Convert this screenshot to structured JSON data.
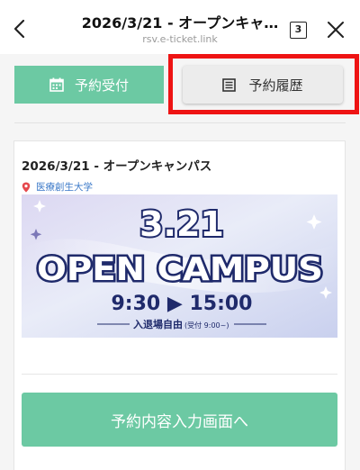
{
  "header": {
    "title": "2026/3/21 - オープンキャ…",
    "subtitle": "rsv.e-ticket.link",
    "tab_count": "3"
  },
  "tabs": {
    "receive_label": "予約受付",
    "history_label": "予約履歴"
  },
  "event": {
    "title": "2026/3/21 - オープンキャンパス",
    "location": "医療創生大学",
    "banner": {
      "date": "3.21",
      "headline": "OPEN CAMPUS",
      "time": "9:30 ▶ 15:00",
      "note": "入退場自由",
      "note_sub": "(受付 9:00~)"
    },
    "cta_label": "予約内容入力画面へ"
  },
  "colors": {
    "accent_green": "#6cc9a3",
    "highlight_red": "#ee1414",
    "link_blue": "#3a78c8",
    "banner_text": "#1f2a6b"
  }
}
